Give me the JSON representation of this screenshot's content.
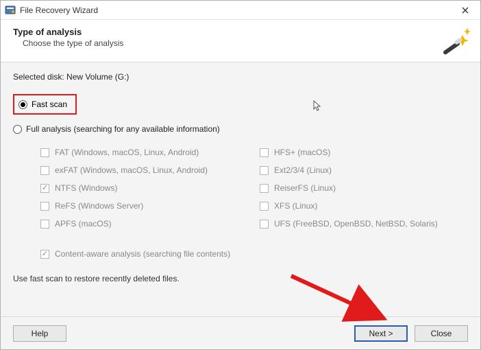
{
  "window": {
    "title": "File Recovery Wizard"
  },
  "header": {
    "title": "Type of analysis",
    "subtitle": "Choose the type of analysis"
  },
  "selected_disk_label": "Selected disk: New Volume (G:)",
  "options": {
    "fast_scan": "Fast scan",
    "full_analysis": "Full analysis (searching for any available information)"
  },
  "filesystems": {
    "left": [
      "FAT (Windows, macOS, Linux, Android)",
      "exFAT (Windows, macOS, Linux, Android)",
      "NTFS (Windows)",
      "ReFS (Windows Server)",
      "APFS (macOS)"
    ],
    "right": [
      "HFS+ (macOS)",
      "Ext2/3/4 (Linux)",
      "ReiserFS (Linux)",
      "XFS (Linux)",
      "UFS (FreeBSD, OpenBSD, NetBSD, Solaris)"
    ]
  },
  "content_aware": "Content-aware analysis (searching file contents)",
  "hint": "Use fast scan to restore recently deleted files.",
  "buttons": {
    "help": "Help",
    "next": "Next >",
    "close": "Close"
  }
}
